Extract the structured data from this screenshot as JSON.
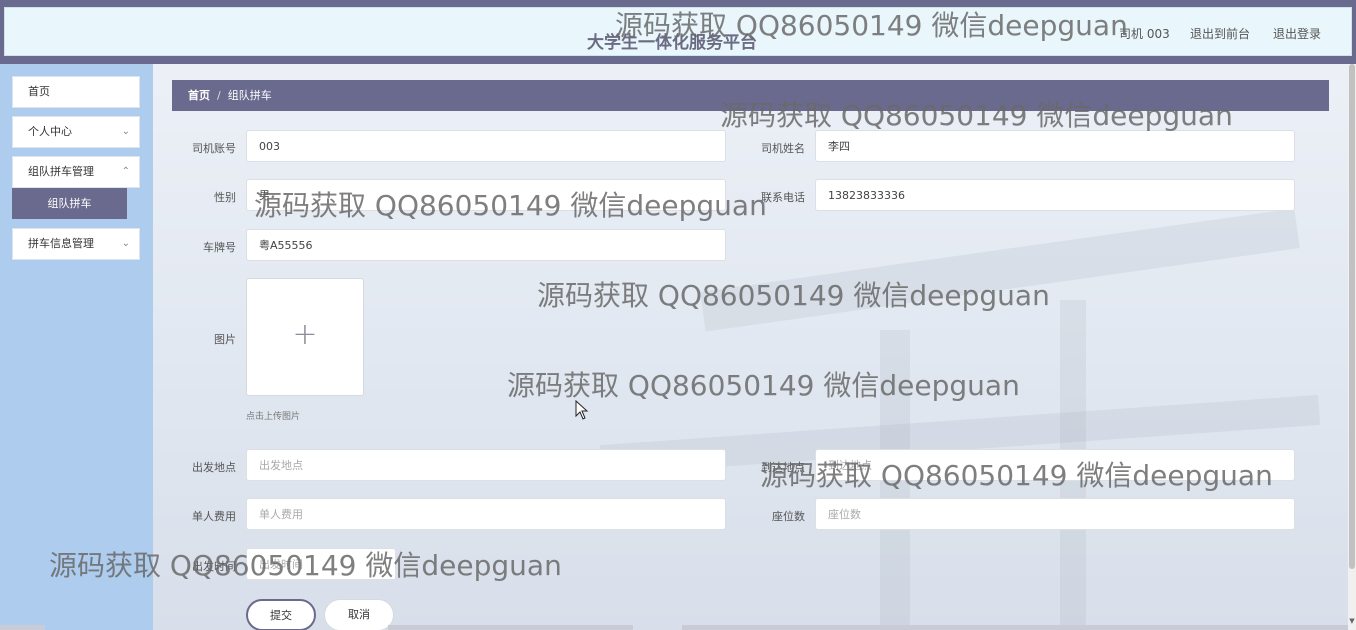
{
  "header": {
    "title": "大学生一体化服务平台",
    "user": "司机 003",
    "to_frontend": "退出到前台",
    "logout": "退出登录"
  },
  "sidebar": {
    "items": [
      {
        "label": "首页"
      },
      {
        "label": "个人中心"
      },
      {
        "label": "组队拼车管理"
      },
      {
        "label": "组队拼车"
      },
      {
        "label": "拼车信息管理"
      }
    ]
  },
  "breadcrumb": {
    "home": "首页",
    "separator": "/",
    "current": "组队拼车"
  },
  "form": {
    "driver_account": {
      "label": "司机账号",
      "value": "003"
    },
    "driver_name": {
      "label": "司机姓名",
      "value": "李四"
    },
    "gender": {
      "label": "性别",
      "value": "男"
    },
    "phone": {
      "label": "联系电话",
      "value": "13823833336"
    },
    "plate": {
      "label": "车牌号",
      "value": "粤A55556"
    },
    "image": {
      "label": "图片",
      "hint": "点击上传图片"
    },
    "departure": {
      "label": "出发地点",
      "placeholder": "出发地点"
    },
    "destination": {
      "label": "到达地点",
      "placeholder": "到达地点"
    },
    "fee": {
      "label": "单人费用",
      "placeholder": "单人费用"
    },
    "seats": {
      "label": "座位数",
      "placeholder": "座位数"
    },
    "depart_time": {
      "label": "出发时间",
      "placeholder": "出发时间"
    },
    "submit": "提交",
    "cancel": "取消"
  },
  "watermark": "源码获取 QQ86050149 微信deepguan"
}
